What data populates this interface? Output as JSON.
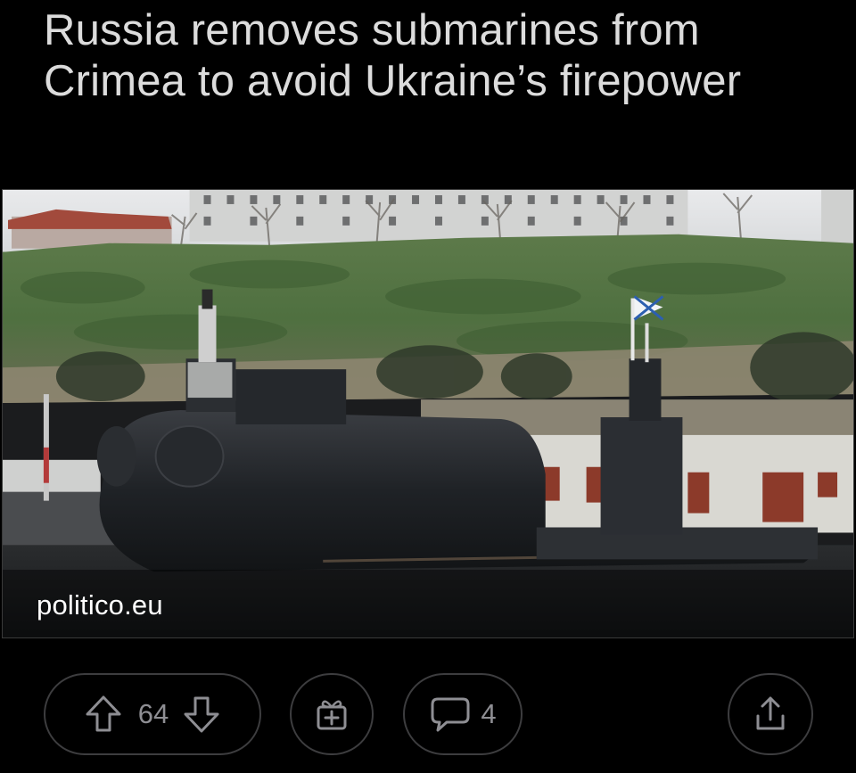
{
  "post": {
    "title": "Russia removes submarines from Crimea to avoid Ukraine’s firepower",
    "source_domain": "politico.eu",
    "image_alt": "Black submarine docked at a naval base in front of a green hillside with buildings",
    "vote_count": "64",
    "comment_count": "4"
  },
  "actions": {
    "upvote_icon": "upvote-arrow-icon",
    "downvote_icon": "downvote-arrow-icon",
    "award_icon": "award-gift-icon",
    "comment_icon": "comment-bubble-icon",
    "share_icon": "share-icon"
  },
  "colors": {
    "background": "#000000",
    "title_text": "#dcdcdc",
    "pill_border": "#3d3d3f",
    "pill_content": "#8e8e93",
    "source_text": "#ffffff"
  }
}
